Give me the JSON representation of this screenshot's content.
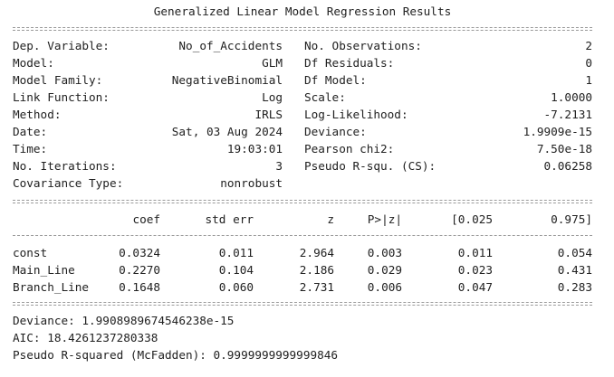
{
  "title": "Generalized Linear Model Regression Results",
  "info_rows": [
    {
      "left_label": "Dep. Variable:",
      "left_value": "No_of_Accidents",
      "right_label": "No. Observations:",
      "right_value": "2"
    },
    {
      "left_label": "Model:",
      "left_value": "GLM",
      "right_label": "Df Residuals:",
      "right_value": "0"
    },
    {
      "left_label": "Model Family:",
      "left_value": "NegativeBinomial",
      "right_label": "Df Model:",
      "right_value": "1"
    },
    {
      "left_label": "Link Function:",
      "left_value": "Log",
      "right_label": "Scale:",
      "right_value": "1.0000"
    },
    {
      "left_label": "Method:",
      "left_value": "IRLS",
      "right_label": "Log-Likelihood:",
      "right_value": "-7.2131"
    },
    {
      "left_label": "Date:",
      "left_value": "Sat, 03 Aug 2024",
      "right_label": "Deviance:",
      "right_value": "1.9909e-15"
    },
    {
      "left_label": "Time:",
      "left_value": "19:03:01",
      "right_label": "Pearson chi2:",
      "right_value": "7.50e-18"
    },
    {
      "left_label": "No. Iterations:",
      "left_value": "3",
      "right_label": "Pseudo R-squ. (CS):",
      "right_value": "0.06258"
    },
    {
      "left_label": "Covariance Type:",
      "left_value": "nonrobust",
      "right_label": "",
      "right_value": ""
    }
  ],
  "coef_headers": [
    "coef",
    "std err",
    "z",
    "P>|z|",
    "[0.025",
    "0.975]"
  ],
  "coef_rows": [
    {
      "name": "const",
      "values": [
        "0.0324",
        "0.011",
        "2.964",
        "0.003",
        "0.011",
        "0.054"
      ]
    },
    {
      "name": "Main_Line",
      "values": [
        "0.2270",
        "0.104",
        "2.186",
        "0.029",
        "0.023",
        "0.431"
      ]
    },
    {
      "name": "Branch_Line",
      "values": [
        "0.1648",
        "0.060",
        "2.731",
        "0.006",
        "0.047",
        "0.283"
      ]
    }
  ],
  "footer": [
    "Deviance: 1.9908989674546238e-15",
    "AIC: 18.4261237280338",
    "Pseudo R-squared (McFadden): 0.9999999999999846"
  ]
}
